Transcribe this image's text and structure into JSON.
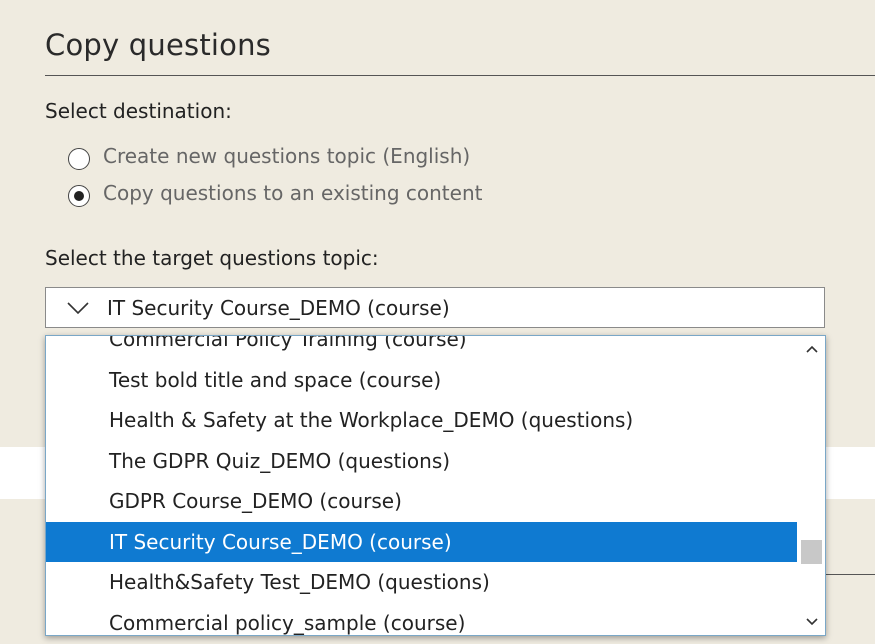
{
  "dialog": {
    "title": "Copy questions",
    "destination_label": "Select destination:",
    "radio_options": [
      {
        "label": "Create new questions topic (English)",
        "checked": false
      },
      {
        "label": "Copy questions to an existing content",
        "checked": true
      }
    ],
    "target_label": "Select the target questions topic:"
  },
  "select": {
    "value": "IT Security Course_DEMO (course)",
    "options": [
      "Commercial Policy Training (course)",
      "Test bold title and space (course)",
      "Health & Safety at the Workplace_DEMO (questions)",
      "The GDPR Quiz_DEMO (questions)",
      "GDPR Course_DEMO (course)",
      "IT Security Course_DEMO (course)",
      "Health&Safety Test_DEMO (questions)",
      "Commercial policy_sample (course)"
    ],
    "selected_index": 5
  },
  "icons": {
    "select_toggle": "chevron-down-icon",
    "scroll_up": "chevron-up-icon",
    "scroll_down": "chevron-down-icon"
  },
  "colors": {
    "background": "#efebe0",
    "selection": "#0f7ad1"
  }
}
